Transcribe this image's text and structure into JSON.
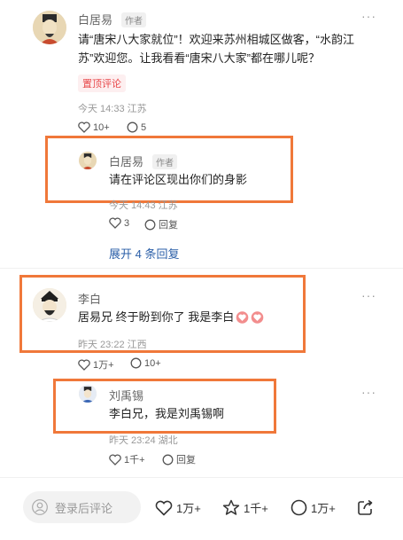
{
  "comments": [
    {
      "name": "白居易",
      "author_tag": "作者",
      "text_line1": "请“唐宋八大家就位”！欢迎来苏州相城区做客，“水韵江",
      "text_line2": "苏”欢迎您。让我看看“唐宋八大家”都在哪儿呢？",
      "pin_label": "置顶评论",
      "meta": "今天 14:33 江苏",
      "likes": "10+",
      "replies": "5",
      "more": "···",
      "reply": {
        "name": "白居易",
        "author_tag": "作者",
        "text": "请在评论区现出你们的身影",
        "meta": "今天 14:43 江苏",
        "likes": "3",
        "reply_label": "回复"
      },
      "expand_label": "展开 4 条回复"
    },
    {
      "name": "李白",
      "text": "居易兄 终于盼到你了 我是李白",
      "meta": "昨天 23:22 江西",
      "likes": "1万+",
      "replies": "10+",
      "more": "···",
      "reply": {
        "name": "刘禹锡",
        "text": "李白兄，我是刘禹锡啊",
        "meta": "昨天 23:24 湖北",
        "likes": "1千+",
        "reply_label": "回复",
        "more": "···"
      }
    }
  ],
  "bottom_bar": {
    "comment_placeholder": "登录后评论",
    "likes": "1万+",
    "reposts": "1千+",
    "comments": "1万+"
  },
  "colors": {
    "highlight": "#f0783a",
    "pin": "#e8484a",
    "link": "#2b5fa8"
  }
}
